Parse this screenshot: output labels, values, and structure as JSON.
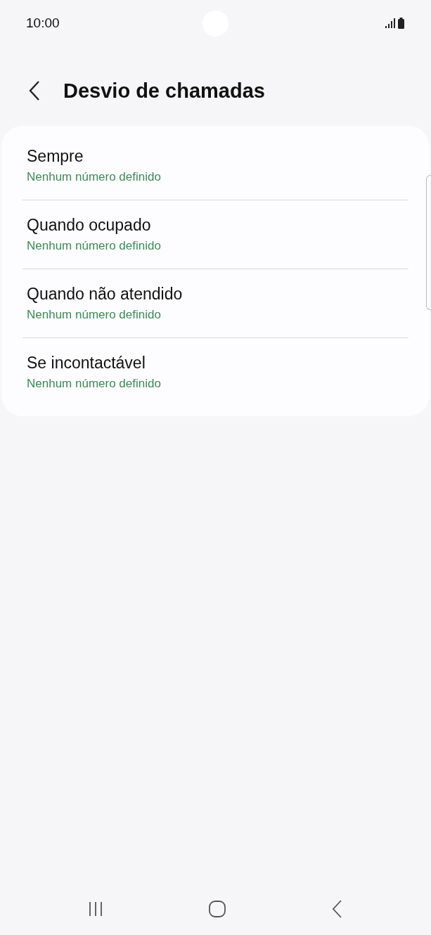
{
  "status_bar": {
    "time": "10:00"
  },
  "header": {
    "title": "Desvio de chamadas"
  },
  "options": [
    {
      "title": "Sempre",
      "subtitle": "Nenhum número definido"
    },
    {
      "title": "Quando ocupado",
      "subtitle": "Nenhum número definido"
    },
    {
      "title": "Quando não atendido",
      "subtitle": "Nenhum número definido"
    },
    {
      "title": "Se incontactável",
      "subtitle": "Nenhum número definido"
    }
  ]
}
